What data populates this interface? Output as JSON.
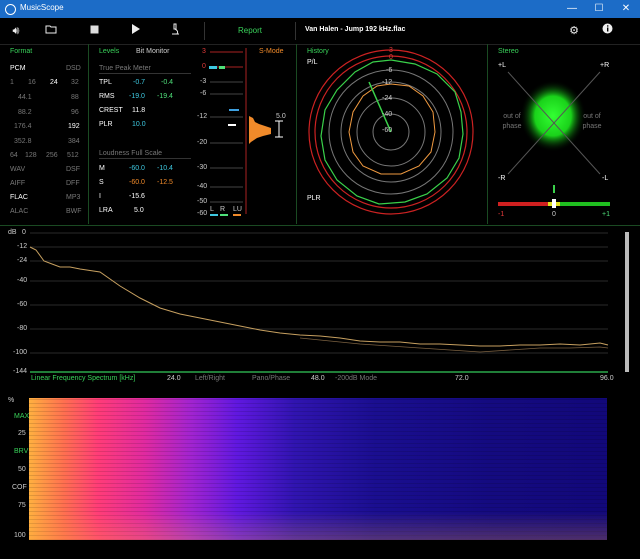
{
  "window": {
    "title": "MusicScope",
    "minimize": "—",
    "maximize": "☐",
    "close": "✕"
  },
  "toolbar": {
    "report": "Report",
    "file": "Van Halen - Jump 192 kHz.flac",
    "icons": [
      "speaker-icon",
      "folder-icon",
      "stop-icon",
      "play-icon",
      "microscope-icon",
      "gear-icon",
      "info-icon"
    ]
  },
  "format": {
    "title": "Format",
    "pcm": "PCM",
    "dsd": "DSD",
    "bits": [
      "1",
      "16",
      "24",
      "32"
    ],
    "rates": [
      [
        "44.1",
        "88"
      ],
      [
        "88.2",
        "96"
      ],
      [
        "176.4",
        "192"
      ],
      [
        "352.8",
        "384"
      ]
    ],
    "dsd_row": [
      "64",
      "128",
      "256",
      "512"
    ],
    "types": [
      [
        "WAV",
        "DSF"
      ],
      [
        "AIFF",
        "DFF"
      ],
      [
        "FLAC",
        "MP3"
      ],
      [
        "ALAC",
        "BWF"
      ]
    ]
  },
  "levels": {
    "title": "Levels",
    "bitmon": "Bit Monitor",
    "tpm": "True Peak Meter",
    "rows": [
      {
        "k": "TPL",
        "a": "-0.7",
        "b": "-0.4"
      },
      {
        "k": "RMS",
        "a": "-19.0",
        "b": "-19.4"
      },
      {
        "k": "CREST",
        "a": "11.8",
        "b": ""
      },
      {
        "k": "PLR",
        "a": "10.0",
        "b": ""
      }
    ],
    "lfs": "Loudness Full Scale",
    "lrows": [
      {
        "k": "M",
        "a": "-60.0",
        "b": "-10.4"
      },
      {
        "k": "S",
        "a": "-60.0",
        "b": "-12.5"
      },
      {
        "k": "I",
        "a": "-15.6",
        "b": ""
      },
      {
        "k": "LRA",
        "a": "5.0",
        "b": ""
      }
    ]
  },
  "meter": {
    "smode": "S-Mode",
    "scale": [
      "3",
      "0",
      "-3",
      "-6",
      "-12",
      "-20",
      "-30",
      "-40",
      "-50",
      "-60"
    ],
    "val": "5.0",
    "lr": [
      "L",
      "R",
      "LU"
    ]
  },
  "history": {
    "title": "History",
    "pl": "P/L",
    "plr": "PLR",
    "rings": [
      "3",
      "0",
      "-6",
      "-12",
      "-24",
      "-40",
      "-60"
    ]
  },
  "stereo": {
    "title": "Stereo",
    "tl": "+L",
    "tr": "+R",
    "bl": "-R",
    "br": "-L",
    "oop": "out of phase",
    "scale": [
      "-1",
      "0",
      "+1"
    ]
  },
  "spectrum": {
    "db": "dB",
    "y": [
      "0",
      "-12",
      "-24",
      "-40",
      "-60",
      "-80",
      "-100",
      "-144"
    ],
    "x": [
      "24.0",
      "48.0",
      "72.0",
      "96.0"
    ],
    "title": "Linear Frequency Spectrum [kHz]",
    "modes": [
      "Left/Right",
      "Pano/Phase",
      "-200dB Mode"
    ]
  },
  "spectrogram": {
    "y": [
      "%",
      "MAX",
      "25",
      "BRV",
      "50",
      "COF",
      "75",
      "100"
    ]
  }
}
